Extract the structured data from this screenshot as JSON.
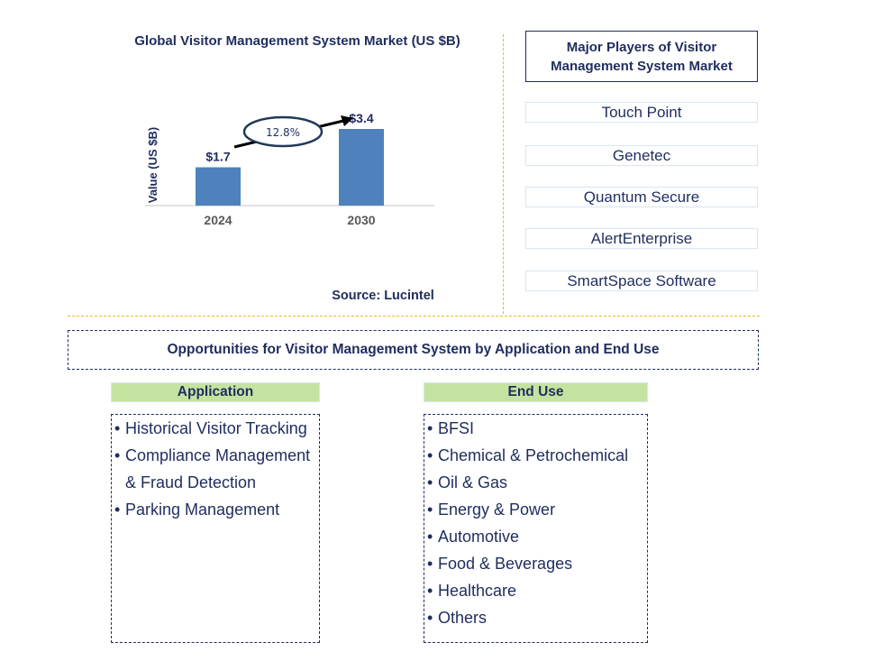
{
  "chart_data": {
    "type": "bar",
    "title": "Global Visitor Management System Market (US $B)",
    "xlabel": "",
    "ylabel": "Value (US $B)",
    "categories": [
      "2024",
      "2030"
    ],
    "values": [
      1.7,
      3.4
    ],
    "data_labels": [
      "$1.7",
      "$3.4"
    ],
    "ylim": [
      0,
      3.4
    ],
    "grid": false,
    "bar_color": "#4f81bd",
    "annotation": {
      "type": "cagr-arrow",
      "label": "12.8%"
    }
  },
  "source": "Source: Lucintel",
  "players": {
    "heading": "Major Players of Visitor Management System Market",
    "heading_lines": [
      "Major Players of Visitor",
      "Management System Market"
    ],
    "items": [
      "Touch Point",
      "Genetec",
      "Quantum Secure",
      "AlertEnterprise",
      "SmartSpace Software"
    ]
  },
  "opportunities": {
    "heading": "Opportunities for Visitor Management System by Application and End Use",
    "application": {
      "label": "Application",
      "items": [
        "Historical Visitor Tracking",
        "Compliance Management",
        "& Fraud Detection",
        "Parking Management"
      ]
    },
    "end_use": {
      "label": "End Use",
      "items": [
        "BFSI",
        "Chemical & Petrochemical",
        "Oil & Gas",
        "Energy & Power",
        "Automotive",
        "Food & Beverages",
        "Healthcare",
        "Others"
      ]
    }
  },
  "colors": {
    "navy": "#1f2d5e",
    "bar": "#4f81bd",
    "divider": "#f5b520",
    "category_header": "#c5e3a0",
    "player_border": "#d6e6f5"
  }
}
